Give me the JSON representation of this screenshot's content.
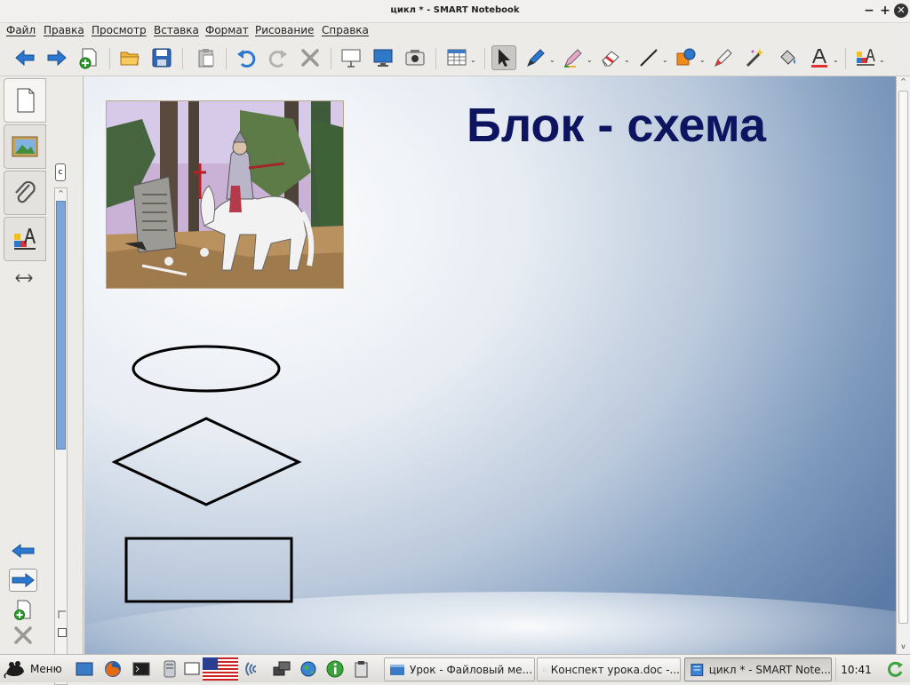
{
  "window": {
    "title": "цикл * - SMART Notebook"
  },
  "menu": [
    "Файл",
    "Правка",
    "Просмотр",
    "Вставка",
    "Формат",
    "Рисование",
    "Справка"
  ],
  "page": {
    "heading": "Блок - схема"
  },
  "sidebar": {
    "autohide_glyph": "c"
  },
  "taskbar": {
    "menu_label": "Меню",
    "tasks": [
      "Урок - Файловый ме...",
      "Конспект урока.doc -...",
      "цикл * - SMART Note..."
    ],
    "clock": "10:41"
  },
  "colors": {
    "heading": "#0d1460",
    "accent": "#2d6fc0",
    "arrow_blue": "#2b78d0"
  }
}
